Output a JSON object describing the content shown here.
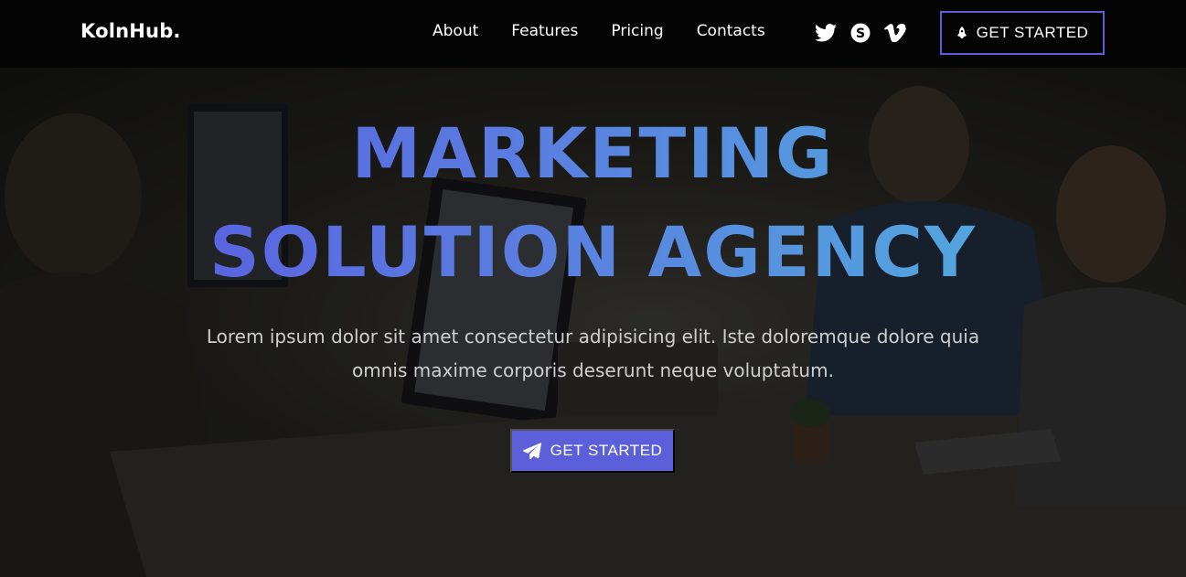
{
  "brand": {
    "logo_text": "KolnHub."
  },
  "nav": {
    "links": [
      "About",
      "Features",
      "Pricing",
      "Contacts"
    ],
    "social_icons": [
      "twitter-icon",
      "skype-icon",
      "vimeo-icon"
    ],
    "cta_label": "GET STARTED",
    "cta_icon": "rocket-icon"
  },
  "hero": {
    "headline_line1": "MARKETING",
    "headline_line2": "SOLUTION AGENCY",
    "subtext": "Lorem ipsum dolor sit amet consectetur adipisicing elit. Iste doloremque dolore quia omnis maxime corporis deserunt neque voluptatum.",
    "cta_label": "GET STARTED",
    "cta_icon": "paper-plane-icon"
  },
  "colors": {
    "accent": "#5b5fd9",
    "gradient_start": "#5a55e0",
    "gradient_end": "#4fb8dc",
    "nav_bg": "#040404"
  }
}
